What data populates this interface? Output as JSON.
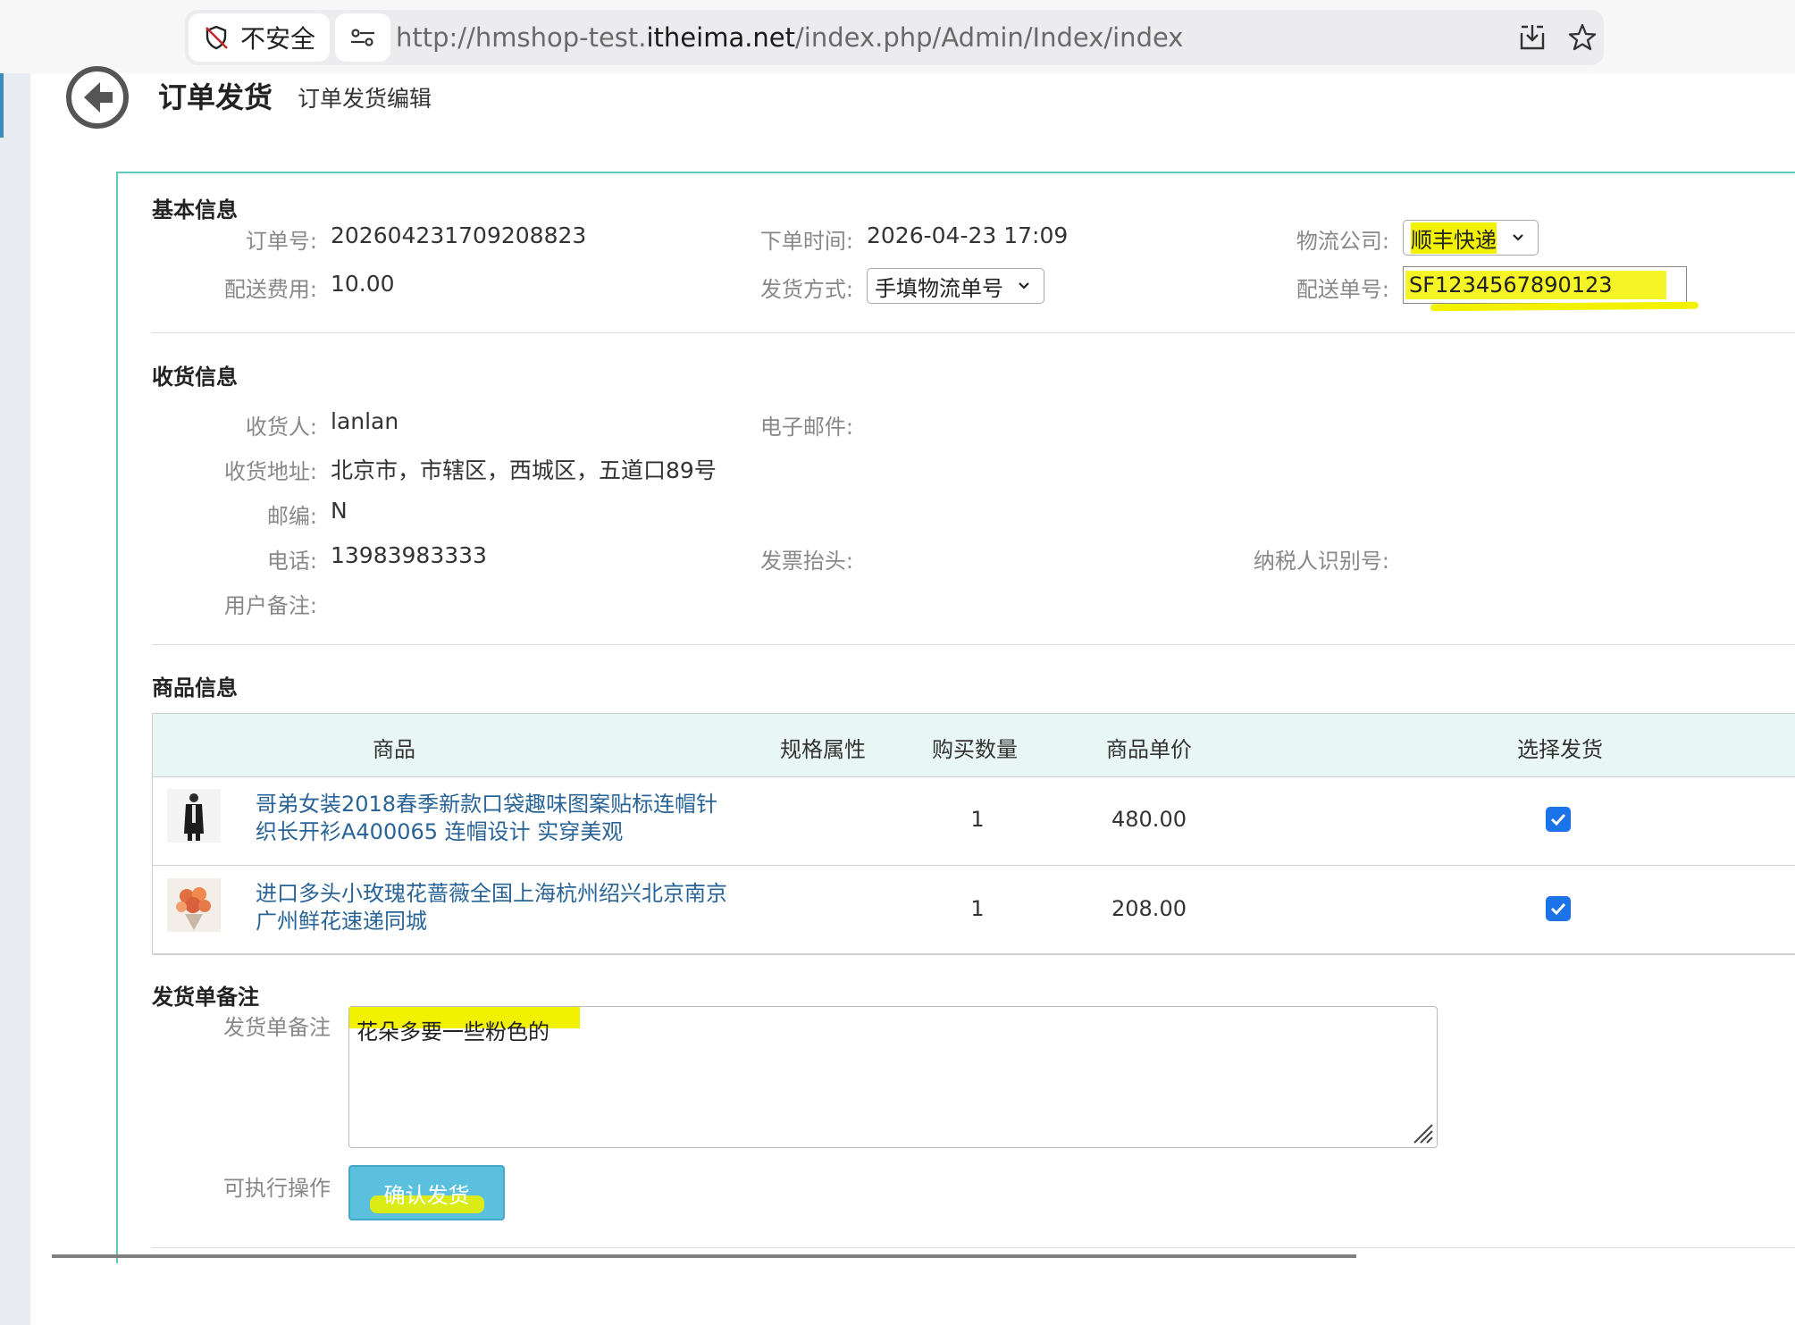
{
  "browser": {
    "security_label": "不安全",
    "url_prefix": "http://hmshop-test.",
    "url_domain": "itheima.net",
    "url_path": "/index.php/Admin/Index/index"
  },
  "header": {
    "title": "订单发货",
    "subtitle": "订单发货编辑"
  },
  "basic_info": {
    "section_title": "基本信息",
    "order_no_label": "订单号:",
    "order_no": "202604231709208823",
    "order_time_label": "下单时间:",
    "order_time": "2026-04-23 17:09",
    "logistics_label": "物流公司:",
    "logistics_value": "顺丰快递",
    "shipping_fee_label": "配送费用:",
    "shipping_fee": "10.00",
    "ship_method_label": "发货方式:",
    "ship_method_value": "手填物流单号",
    "tracking_no_label": "配送单号:",
    "tracking_no": "SF1234567890123"
  },
  "receiver_info": {
    "section_title": "收货信息",
    "receiver_label": "收货人:",
    "receiver": "lanlan",
    "email_label": "电子邮件:",
    "address_label": "收货地址:",
    "address": "北京市，市辖区，西城区，五道口89号",
    "zip_label": "邮编:",
    "zip": "N",
    "phone_label": "电话:",
    "phone": "13983983333",
    "invoice_label": "发票抬头:",
    "tax_id_label": "纳税人识别号:",
    "remark_label": "用户备注:"
  },
  "goods_info": {
    "section_title": "商品信息",
    "columns": [
      "商品",
      "规格属性",
      "购买数量",
      "商品单价",
      "选择发货"
    ],
    "rows": [
      {
        "name": "哥弟女装2018春季新款口袋趣味图案贴标连帽针织长开衫A400065 连帽设计 实穿美观",
        "qty": "1",
        "price": "480.00",
        "checked": true
      },
      {
        "name": "进口多头小玫瑰花蔷薇全国上海杭州绍兴北京南京广州鲜花速递同城",
        "qty": "1",
        "price": "208.00",
        "checked": true
      }
    ]
  },
  "delivery_note": {
    "section_title": "发货单备注",
    "field_label": "发货单备注",
    "value": "花朵多要一些粉色的"
  },
  "actions": {
    "label": "可执行操作",
    "confirm_button": "确认发货"
  },
  "colors": {
    "panel_border": "#5ecab8",
    "table_header_bg": "#e8f7f3",
    "link": "#2a6496",
    "button": "#5bc0de",
    "highlight": "#f2f200",
    "checkbox": "#1a73e8"
  }
}
